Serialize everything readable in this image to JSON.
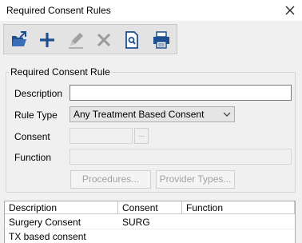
{
  "window": {
    "title": "Required Consent Rules"
  },
  "icons": {
    "close": "close-icon",
    "open": "open-folder-icon",
    "add": "plus-icon",
    "edit": "pencil-icon",
    "delete": "x-icon",
    "preview": "print-preview-icon",
    "print": "printer-icon"
  },
  "form": {
    "group_title": "Required Consent Rule",
    "description_label": "Description",
    "description_value": "",
    "rule_type_label": "Rule Type",
    "rule_type_value": "Any Treatment Based Consent",
    "consent_label": "Consent",
    "consent_value": "",
    "ellipsis_label": "...",
    "function_label": "Function",
    "function_value": "",
    "procedures_button": "Procedures...",
    "provider_types_button": "Provider Types..."
  },
  "grid": {
    "columns": [
      "Description",
      "Consent",
      "Function"
    ],
    "rows": [
      [
        "Surgery Consent",
        "SURG",
        ""
      ],
      [
        "TX based consent",
        "",
        ""
      ]
    ]
  },
  "colors": {
    "toolbar_blue": "#1d4f91",
    "disabled_icon": "#9a9a9a",
    "background": "#f0f0f0"
  }
}
